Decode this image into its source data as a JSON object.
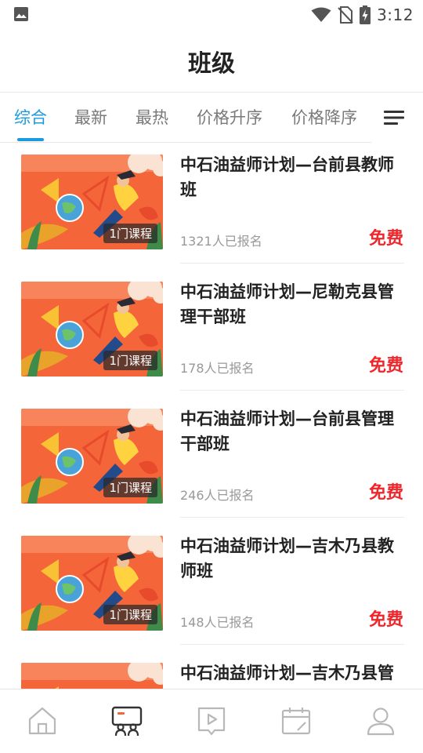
{
  "status_bar": {
    "time": "3:12",
    "icons": [
      "image-icon",
      "wifi-icon",
      "no-sim-icon",
      "battery-charging-icon"
    ]
  },
  "header": {
    "title": "班级"
  },
  "tabs": [
    {
      "label": "综合",
      "active": true
    },
    {
      "label": "最新",
      "active": false
    },
    {
      "label": "最热",
      "active": false
    },
    {
      "label": "价格升序",
      "active": false
    },
    {
      "label": "价格降序",
      "active": false
    }
  ],
  "sort_menu_icon": "menu-icon",
  "courses": [
    {
      "title": "中石油益师计划—台前县教师班",
      "badge": "1门课程",
      "enrolled": "1321人已报名",
      "price": "免费"
    },
    {
      "title": "中石油益师计划—尼勒克县管理干部班",
      "badge": "1门课程",
      "enrolled": "178人已报名",
      "price": "免费"
    },
    {
      "title": "中石油益师计划—台前县管理干部班",
      "badge": "1门课程",
      "enrolled": "246人已报名",
      "price": "免费"
    },
    {
      "title": "中石油益师计划—吉木乃县教师班",
      "badge": "1门课程",
      "enrolled": "148人已报名",
      "price": "免费"
    },
    {
      "title": "中石油益师计划—吉木乃县管",
      "badge": "",
      "enrolled": "",
      "price": ""
    }
  ],
  "bottom_nav": [
    {
      "icon": "home-icon",
      "active": false
    },
    {
      "icon": "class-icon",
      "active": true
    },
    {
      "icon": "video-icon",
      "active": false
    },
    {
      "icon": "calendar-icon",
      "active": false
    },
    {
      "icon": "profile-icon",
      "active": false
    }
  ],
  "colors": {
    "accent": "#1a9be0",
    "price": "#f0262b",
    "thumb_bg": "#f4663a"
  }
}
